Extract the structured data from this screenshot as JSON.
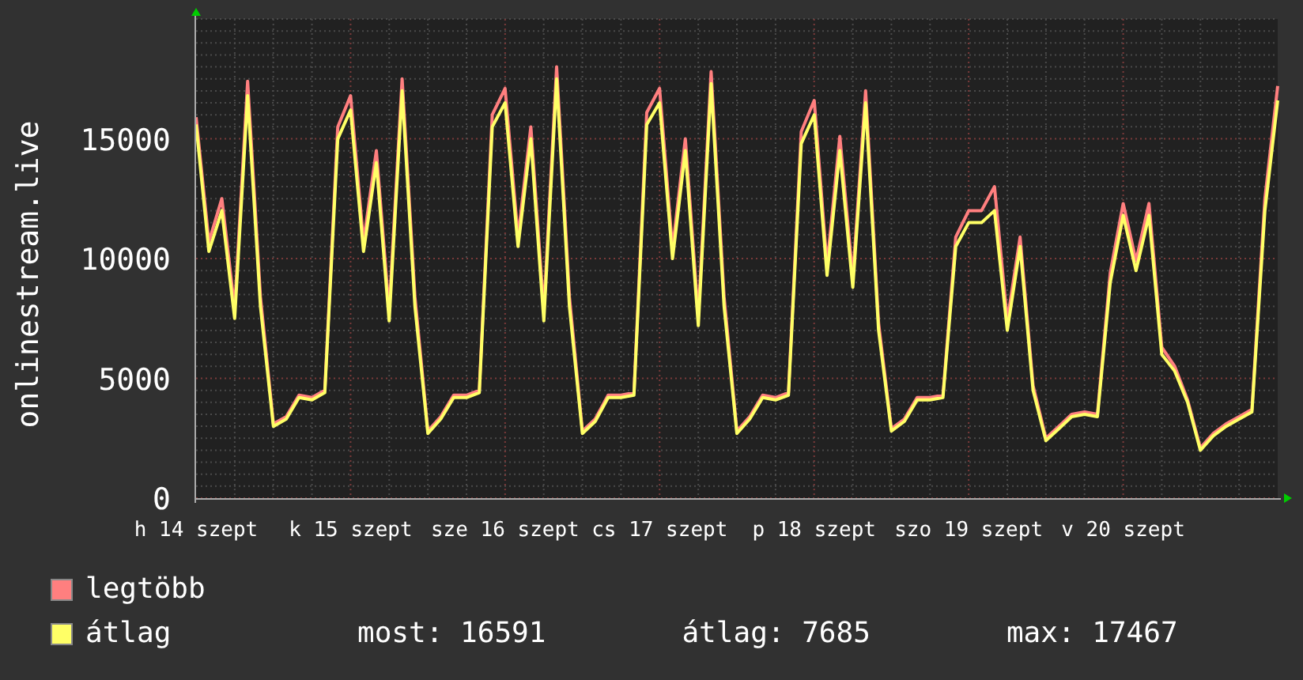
{
  "chart_data": {
    "type": "line",
    "grid": true,
    "ylabel": "onlinestream.live",
    "ylim": [
      0,
      20000
    ],
    "yticks": [
      0,
      5000,
      10000,
      15000
    ],
    "categories": [
      "h 14 szept",
      null,
      null,
      null,
      null,
      null,
      null,
      null,
      null,
      null,
      null,
      null,
      "k 15 szept",
      null,
      null,
      null,
      null,
      null,
      null,
      null,
      null,
      null,
      null,
      null,
      "sze 16 szept",
      null,
      null,
      null,
      null,
      null,
      null,
      null,
      null,
      null,
      null,
      null,
      "cs 17 szept",
      null,
      null,
      null,
      null,
      null,
      null,
      null,
      null,
      null,
      null,
      null,
      "p 18 szept",
      null,
      null,
      null,
      null,
      null,
      null,
      null,
      null,
      null,
      null,
      null,
      "szo 19 szept",
      null,
      null,
      null,
      null,
      null,
      null,
      null,
      null,
      null,
      null,
      null,
      "v 20 szept",
      null,
      null,
      null,
      null,
      null,
      null,
      null,
      null,
      null,
      null,
      null,
      null
    ],
    "series": [
      {
        "name": "legtöbb",
        "color": "#ff7f7f",
        "values": [
          15900,
          10700,
          12500,
          7900,
          17400,
          8400,
          3100,
          3400,
          4300,
          4200,
          4500,
          15500,
          16800,
          10700,
          14500,
          7800,
          17500,
          8400,
          2800,
          3400,
          4300,
          4300,
          4500,
          16000,
          17100,
          10900,
          15500,
          7800,
          18000,
          8400,
          2800,
          3300,
          4300,
          4300,
          4400,
          16100,
          17100,
          10400,
          15000,
          7600,
          17800,
          8400,
          2800,
          3400,
          4300,
          4200,
          4400,
          15300,
          16600,
          9700,
          15100,
          9200,
          17000,
          7300,
          2900,
          3300,
          4200,
          4200,
          4300,
          10900,
          12000,
          12000,
          13000,
          7400,
          10900,
          4700,
          2500,
          3000,
          3500,
          3600,
          3500,
          9400,
          12300,
          9900,
          12300,
          6300,
          5500,
          4100,
          2100,
          2700,
          3100,
          3400,
          3700,
          12500,
          17200
        ]
      },
      {
        "name": "átlag",
        "color": "#ffff66",
        "values": [
          15600,
          10300,
          12000,
          7500,
          16800,
          8000,
          3000,
          3300,
          4200,
          4100,
          4400,
          15000,
          16200,
          10300,
          14000,
          7400,
          17000,
          8000,
          2700,
          3300,
          4200,
          4200,
          4400,
          15500,
          16500,
          10500,
          15000,
          7400,
          17500,
          8000,
          2700,
          3200,
          4200,
          4200,
          4300,
          15600,
          16500,
          10000,
          14500,
          7200,
          17300,
          8000,
          2700,
          3300,
          4200,
          4100,
          4300,
          14800,
          16000,
          9300,
          14500,
          8800,
          16500,
          7000,
          2800,
          3200,
          4100,
          4100,
          4200,
          10500,
          11500,
          11500,
          12000,
          7000,
          10500,
          4500,
          2400,
          2900,
          3400,
          3500,
          3400,
          9000,
          11800,
          9500,
          11800,
          6000,
          5300,
          4000,
          2000,
          2600,
          3000,
          3300,
          3600,
          12000,
          16600
        ]
      }
    ]
  },
  "stats": [
    "most: 16591",
    "átlag: 7685",
    "max: 17467"
  ]
}
